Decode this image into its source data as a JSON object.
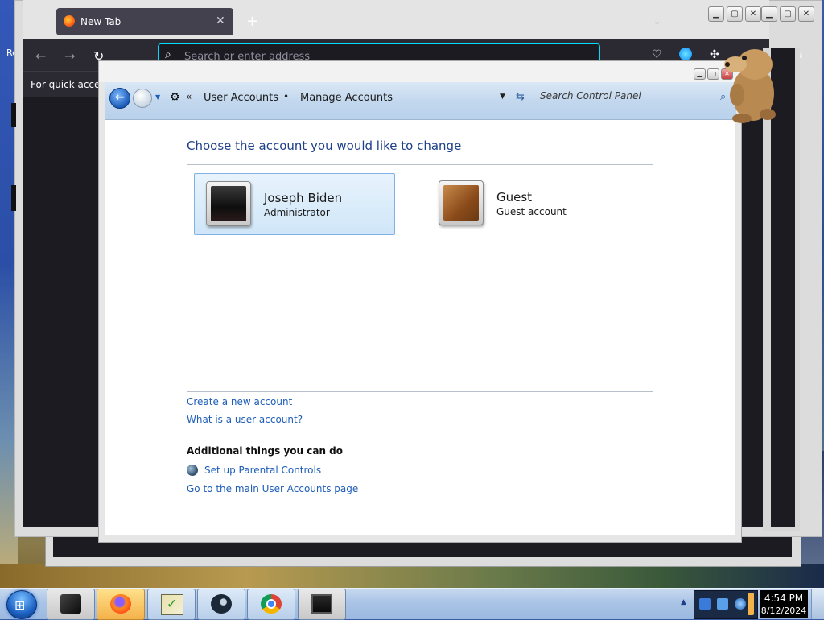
{
  "desktop": {
    "partial_icon_label": "Re"
  },
  "firefox": {
    "tab": {
      "title": "New Tab",
      "close_glyph": "✕"
    },
    "new_tab_glyph": "+",
    "list_tabs_glyph": "⌄",
    "nav": {
      "back_glyph": "←",
      "forward_glyph": "→",
      "reload_glyph": "↻"
    },
    "url_placeholder": "Search or enter address",
    "bookmarks_text": "For quick access",
    "menu_glyph": "≡"
  },
  "control_panel": {
    "breadcrumb": [
      {
        "label": "User Accounts"
      },
      {
        "label": "Manage Accounts"
      }
    ],
    "breadcrumb_separator": "•",
    "breadcrumb_lead": "«",
    "search_placeholder": "Search Control Panel",
    "heading": "Choose the account you would like to change",
    "accounts": [
      {
        "name": "Joseph Biden",
        "type": "Administrator",
        "selected": true
      },
      {
        "name": "Guest",
        "type": "Guest account",
        "selected": false
      }
    ],
    "links": {
      "create_account": "Create a new account",
      "what_is_account": "What is a user account?"
    },
    "additional": {
      "heading": "Additional things you can do",
      "parental_controls": "Set up Parental Controls",
      "main_page": "Go to the main User Accounts page"
    }
  },
  "taskbar": {
    "buttons": [
      {
        "name": "tablet-app",
        "icon": "black-device-icon"
      },
      {
        "name": "firefox",
        "icon": "firefox-icon",
        "active": true
      },
      {
        "name": "checklist-app",
        "icon": "checklist-icon"
      },
      {
        "name": "steam",
        "icon": "steam-icon"
      },
      {
        "name": "chrome",
        "icon": "chrome-icon"
      },
      {
        "name": "screen-app",
        "icon": "monitor-icon"
      }
    ],
    "clock": {
      "time": "4:54 PM",
      "date": "8/12/2024"
    }
  }
}
